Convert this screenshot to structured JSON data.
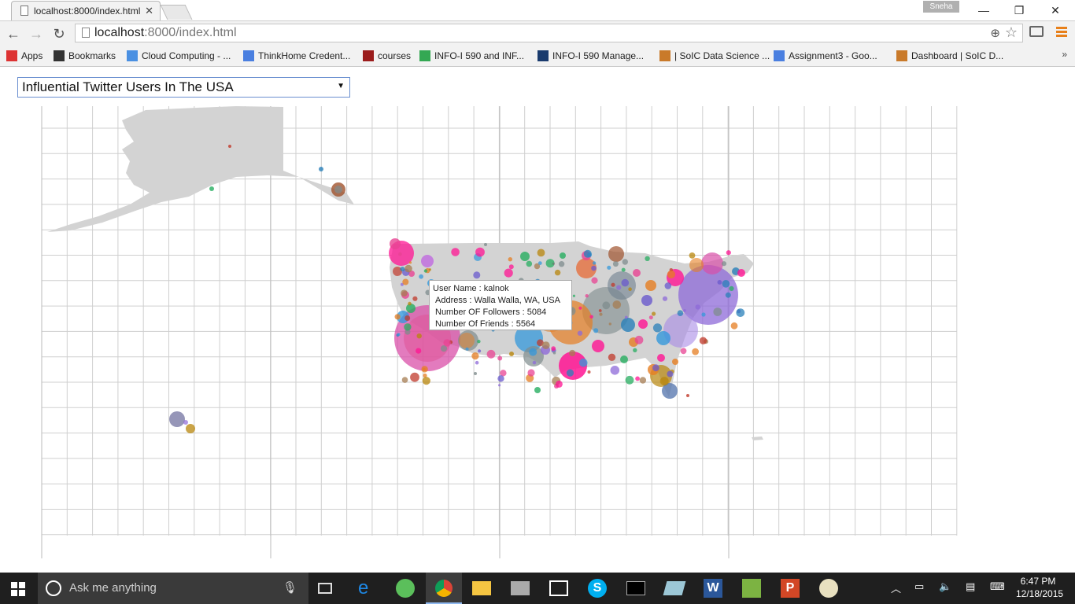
{
  "browser": {
    "tab_title": "localhost:8000/index.html",
    "user_badge": "Sneha",
    "url_host": "localhost",
    "url_rest": ":8000/index.html",
    "bookmarks": [
      {
        "label": "Apps",
        "icon": "apps-grid-icon",
        "color": "#d33"
      },
      {
        "label": "Bookmarks",
        "icon": "star-icon",
        "color": "#333"
      },
      {
        "label": "Cloud Computing - ...",
        "icon": "drive-icon",
        "color": "#4a90e2"
      },
      {
        "label": "ThinkHome Credent...",
        "icon": "doc-icon",
        "color": "#4a7fe0"
      },
      {
        "label": "courses",
        "icon": "iu-trident-icon",
        "color": "#9b1c1c"
      },
      {
        "label": "INFO-I 590 and INF...",
        "icon": "google-icon",
        "color": "#34a853"
      },
      {
        "label": "INFO-I 590 Manage...",
        "icon": "manage-icon",
        "color": "#1a3b6e"
      },
      {
        "label": "| SoIC Data Science ...",
        "icon": "soic-icon",
        "color": "#c97a2a"
      },
      {
        "label": "Assignment3 - Goo...",
        "icon": "doc-icon",
        "color": "#4a7fe0"
      },
      {
        "label": "Dashboard | SoIC D...",
        "icon": "soic-icon",
        "color": "#c97a2a"
      }
    ],
    "bookmarks_overflow": "»"
  },
  "page": {
    "dropdown_selected": "Influential Twitter Users In The USA",
    "tooltip": {
      "line1": "User Name : kalnok",
      "line2": "Address : Walla Walla, WA, USA",
      "line3": "Number OF Followers : 5084",
      "line4": "Number Of Friends : 5564"
    }
  },
  "taskbar": {
    "search_placeholder": "Ask me anything",
    "time": "6:47 PM",
    "date": "12/18/2015"
  },
  "colors": {
    "map_land": "#d3d3d3",
    "grid": "#cfcfcf",
    "accent_menu": "#e8801a"
  }
}
